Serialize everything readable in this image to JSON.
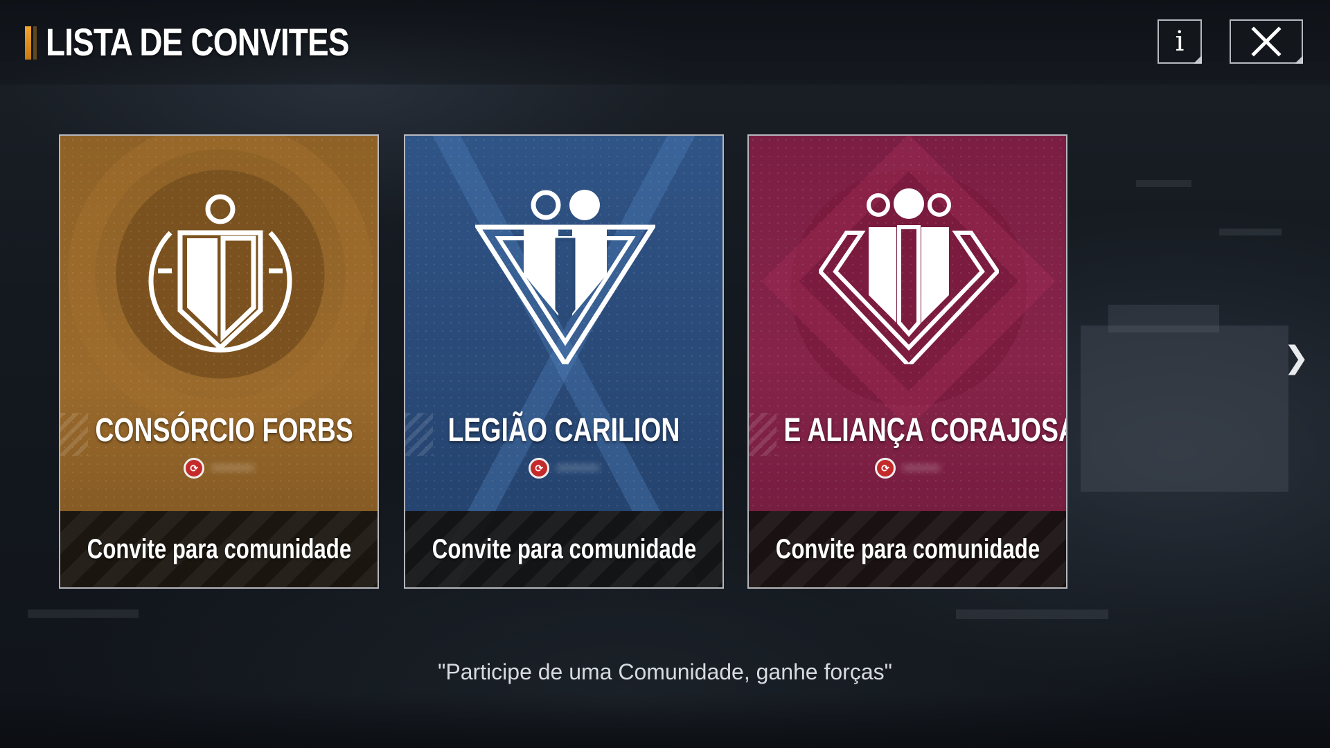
{
  "header": {
    "title": "LISTA DE CONVITES",
    "info_label": "i"
  },
  "cards": [
    {
      "name": "CONSÓRCIO FORBS",
      "meta_value": "••••••••",
      "invite_label": "Convite para comunidade",
      "color": "#9a6a2c",
      "emblem": "shield-ring-emblem-icon"
    },
    {
      "name": "LEGIÃO CARILION",
      "meta_value": "••••••••",
      "invite_label": "Convite para comunidade",
      "color": "#2f5486",
      "emblem": "triangle-emblem-icon"
    },
    {
      "name": "E ALIANÇA CORAJOSA",
      "meta_value": "•••••••",
      "invite_label": "Convite para comunidade",
      "color": "#862449",
      "emblem": "diamond-emblem-icon"
    }
  ],
  "tagline": "\"Participe de uma Comunidade, ganhe forças\"",
  "nav": {
    "next_glyph": "❯"
  }
}
